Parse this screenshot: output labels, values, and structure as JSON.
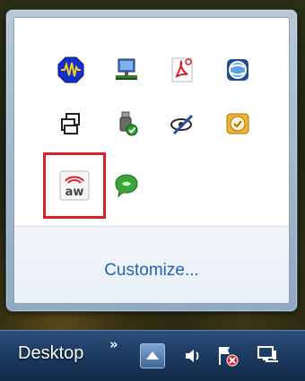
{
  "tray_flyout": {
    "customize_label": "Customize...",
    "icons": [
      {
        "row": 1,
        "col": 1,
        "icon": "blue-octagon-waveform-icon"
      },
      {
        "row": 1,
        "col": 2,
        "icon": "network-monitor-icon"
      },
      {
        "row": 1,
        "col": 3,
        "icon": "adobe-pdf-icon"
      },
      {
        "row": 1,
        "col": 4,
        "icon": "globe-sync-icon"
      },
      {
        "row": 2,
        "col": 1,
        "icon": "overlapping-windows-icon"
      },
      {
        "row": 2,
        "col": 2,
        "icon": "usb-device-check-icon"
      },
      {
        "row": 2,
        "col": 3,
        "icon": "eye-pen-icon"
      },
      {
        "row": 2,
        "col": 4,
        "icon": "outlook-reminder-icon"
      },
      {
        "row": 3,
        "col": 1,
        "icon": "airwatch-aw-icon",
        "highlighted": true,
        "badge_text": "aw"
      },
      {
        "row": 3,
        "col": 2,
        "icon": "green-chat-bubble-icon"
      }
    ],
    "highlight_color": "#d8232a"
  },
  "taskbar": {
    "desktop_label": "Desktop",
    "overflow_chevron": "»",
    "tray_icons": [
      "show-hidden-icons-icon",
      "volume-icon",
      "action-center-flag-error-icon",
      "network-icon"
    ]
  }
}
